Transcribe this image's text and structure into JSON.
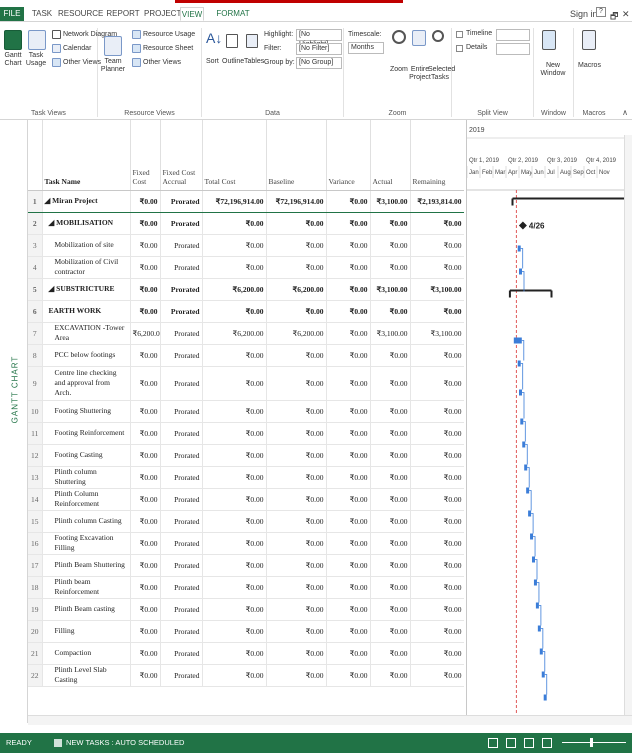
{
  "tabs": [
    "FILE",
    "TASK",
    "RESOURCE",
    "REPORT",
    "PROJECT",
    "VIEW",
    "FORMAT"
  ],
  "window": {
    "signin": "Sign in",
    "help": "?",
    "restore": "🗗",
    "close": "✕"
  },
  "ribbon": {
    "task_views": {
      "gantt": "Gantt Chart",
      "task_usage": "Task Usage",
      "network": "Network Diagram",
      "calendar": "Calendar",
      "other": "Other Views",
      "label": "Task Views"
    },
    "resource_views": {
      "team": "Team Planner",
      "usage": "Resource Usage",
      "sheet": "Resource Sheet",
      "other": "Other Views",
      "label": "Resource Views"
    },
    "data": {
      "sort": "Sort",
      "outline": "Outline",
      "tables": "Tables",
      "highlight": "Highlight:",
      "highlight_val": "[No Highlight]",
      "filter": "Filter:",
      "filter_val": "[No Filter]",
      "group": "Group by:",
      "group_val": "[No Group]",
      "label": "Data"
    },
    "zoom": {
      "timescale": "Timescale:",
      "timescale_val": "Months",
      "zoom": "Zoom",
      "entire": "Entire Project",
      "selected": "Selected Tasks",
      "label": "Zoom"
    },
    "split": {
      "timeline": "Timeline",
      "details": "Details",
      "label": "Split View"
    },
    "window": {
      "new": "New Window",
      "label": "Window"
    },
    "macros": {
      "macros": "Macros",
      "label": "Macros"
    }
  },
  "side_label": "GANTT CHART",
  "columns": [
    "Task Name",
    "Fixed Cost",
    "Fixed Cost Accrual",
    "Total Cost",
    "Baseline",
    "Variance",
    "Actual",
    "Remaining"
  ],
  "rows": [
    {
      "id": "1",
      "name": "◢ Miran Project",
      "fc": "₹0.00",
      "acc": "Prorated",
      "total": "₹72,196,914.00",
      "base": "₹72,196,914.00",
      "var": "₹0.00",
      "act": "₹3,100.00",
      "rem": "₹2,193,814.00",
      "sum": true,
      "sel": true
    },
    {
      "id": "2",
      "name": "◢ MOBILISATION",
      "fc": "₹0.00",
      "acc": "Prorated",
      "total": "₹0.00",
      "base": "₹0.00",
      "var": "₹0.00",
      "act": "₹0.00",
      "rem": "₹0.00",
      "sum": true
    },
    {
      "id": "3",
      "name": "Mobilization of site",
      "fc": "₹0.00",
      "acc": "Prorated",
      "total": "₹0.00",
      "base": "₹0.00",
      "var": "₹0.00",
      "act": "₹0.00",
      "rem": "₹0.00"
    },
    {
      "id": "4",
      "name": "Mobilization of Civil contractor",
      "fc": "₹0.00",
      "acc": "Prorated",
      "total": "₹0.00",
      "base": "₹0.00",
      "var": "₹0.00",
      "act": "₹0.00",
      "rem": "₹0.00"
    },
    {
      "id": "5",
      "name": "◢ SUBSTRICTURE",
      "fc": "₹0.00",
      "acc": "Prorated",
      "total": "₹6,200.00",
      "base": "₹6,200.00",
      "var": "₹0.00",
      "act": "₹3,100.00",
      "rem": "₹3,100.00",
      "sum": true
    },
    {
      "id": "6",
      "name": "EARTH WORK",
      "fc": "₹0.00",
      "acc": "Prorated",
      "total": "₹0.00",
      "base": "₹0.00",
      "var": "₹0.00",
      "act": "₹0.00",
      "rem": "₹0.00",
      "sum": true
    },
    {
      "id": "7",
      "name": "EXCAVATION -Tower Area",
      "fc": "₹6,200.00",
      "acc": "Prorated",
      "total": "₹6,200.00",
      "base": "₹6,200.00",
      "var": "₹0.00",
      "act": "₹3,100.00",
      "rem": "₹3,100.00"
    },
    {
      "id": "8",
      "name": "PCC below footings",
      "fc": "₹0.00",
      "acc": "Prorated",
      "total": "₹0.00",
      "base": "₹0.00",
      "var": "₹0.00",
      "act": "₹0.00",
      "rem": "₹0.00"
    },
    {
      "id": "9",
      "name": "Centre line checking and approval from Arch.",
      "fc": "₹0.00",
      "acc": "Prorated",
      "total": "₹0.00",
      "base": "₹0.00",
      "var": "₹0.00",
      "act": "₹0.00",
      "rem": "₹0.00",
      "tall": true
    },
    {
      "id": "10",
      "name": "Footing Shuttering",
      "fc": "₹0.00",
      "acc": "Prorated",
      "total": "₹0.00",
      "base": "₹0.00",
      "var": "₹0.00",
      "act": "₹0.00",
      "rem": "₹0.00"
    },
    {
      "id": "11",
      "name": "Footing Reinforcement",
      "fc": "₹0.00",
      "acc": "Prorated",
      "total": "₹0.00",
      "base": "₹0.00",
      "var": "₹0.00",
      "act": "₹0.00",
      "rem": "₹0.00"
    },
    {
      "id": "12",
      "name": "Footing Casting",
      "fc": "₹0.00",
      "acc": "Prorated",
      "total": "₹0.00",
      "base": "₹0.00",
      "var": "₹0.00",
      "act": "₹0.00",
      "rem": "₹0.00"
    },
    {
      "id": "13",
      "name": "Plinth column Shuttering",
      "fc": "₹0.00",
      "acc": "Prorated",
      "total": "₹0.00",
      "base": "₹0.00",
      "var": "₹0.00",
      "act": "₹0.00",
      "rem": "₹0.00"
    },
    {
      "id": "14",
      "name": "Plinth Column Reinforcement",
      "fc": "₹0.00",
      "acc": "Prorated",
      "total": "₹0.00",
      "base": "₹0.00",
      "var": "₹0.00",
      "act": "₹0.00",
      "rem": "₹0.00"
    },
    {
      "id": "15",
      "name": "Plinth column Casting",
      "fc": "₹0.00",
      "acc": "Prorated",
      "total": "₹0.00",
      "base": "₹0.00",
      "var": "₹0.00",
      "act": "₹0.00",
      "rem": "₹0.00"
    },
    {
      "id": "16",
      "name": "Footing Excavation Filling",
      "fc": "₹0.00",
      "acc": "Prorated",
      "total": "₹0.00",
      "base": "₹0.00",
      "var": "₹0.00",
      "act": "₹0.00",
      "rem": "₹0.00"
    },
    {
      "id": "17",
      "name": "Plinth Beam Shuttering",
      "fc": "₹0.00",
      "acc": "Prorated",
      "total": "₹0.00",
      "base": "₹0.00",
      "var": "₹0.00",
      "act": "₹0.00",
      "rem": "₹0.00"
    },
    {
      "id": "18",
      "name": "Plinth beam Reinforcement",
      "fc": "₹0.00",
      "acc": "Prorated",
      "total": "₹0.00",
      "base": "₹0.00",
      "var": "₹0.00",
      "act": "₹0.00",
      "rem": "₹0.00"
    },
    {
      "id": "19",
      "name": "Plinth Beam casting",
      "fc": "₹0.00",
      "acc": "Prorated",
      "total": "₹0.00",
      "base": "₹0.00",
      "var": "₹0.00",
      "act": "₹0.00",
      "rem": "₹0.00"
    },
    {
      "id": "20",
      "name": "Filling",
      "fc": "₹0.00",
      "acc": "Prorated",
      "total": "₹0.00",
      "base": "₹0.00",
      "var": "₹0.00",
      "act": "₹0.00",
      "rem": "₹0.00"
    },
    {
      "id": "21",
      "name": "Compaction",
      "fc": "₹0.00",
      "acc": "Prorated",
      "total": "₹0.00",
      "base": "₹0.00",
      "var": "₹0.00",
      "act": "₹0.00",
      "rem": "₹0.00"
    },
    {
      "id": "22",
      "name": "Plinth Level Slab Casting",
      "fc": "₹0.00",
      "acc": "Prorated",
      "total": "₹0.00",
      "base": "₹0.00",
      "var": "₹0.00",
      "act": "₹0.00",
      "rem": "₹0.00"
    }
  ],
  "gantt": {
    "year": "2019",
    "quarters": [
      "Qtr 1, 2019",
      "Qtr 2, 2019",
      "Qtr 3, 2019",
      "Qtr 4, 2019"
    ],
    "months": [
      "Jan",
      "Feb",
      "Mar",
      "Apr",
      "May",
      "Jun",
      "Jul",
      "Aug",
      "Sep",
      "Oct",
      "Nov"
    ],
    "milestone_label": "4/26",
    "accent": "#217346",
    "bar_color": "#3b7dd8"
  },
  "status": {
    "ready": "READY",
    "mode": "NEW TASKS : AUTO SCHEDULED"
  }
}
